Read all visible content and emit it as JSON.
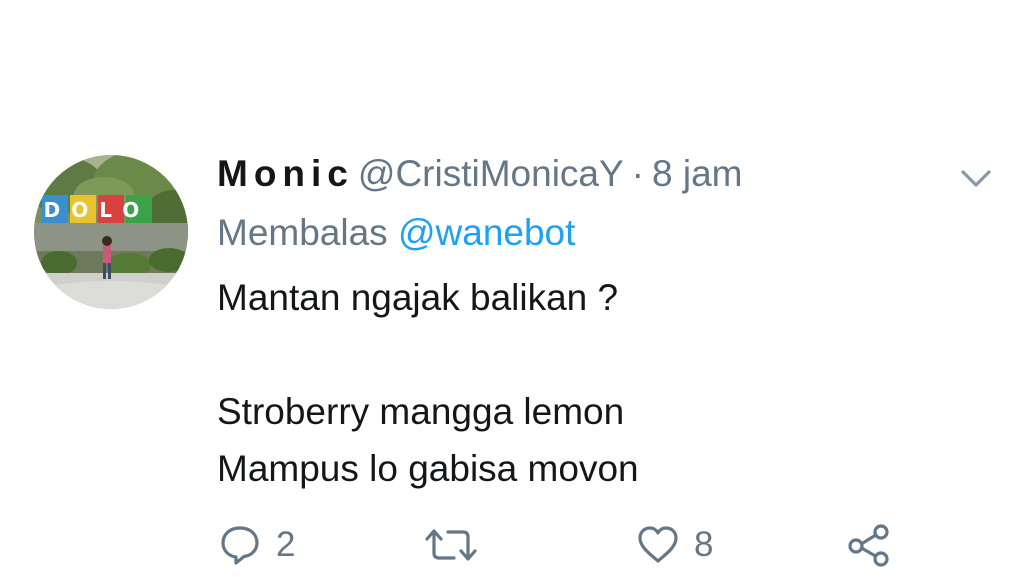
{
  "tweet": {
    "display_name": "Monic",
    "handle": "@CristiMonicaY",
    "separator": "·",
    "time": "8 jam",
    "reply_prefix": "Membalas",
    "reply_to": "@wanebot",
    "text": "Mantan ngajak balikan ?\n\nStroberry mangga lemon\nMampus lo gabisa movon",
    "avatar_sign_text": "DOLO"
  },
  "actions": {
    "reply_count": "2",
    "retweet_count": "",
    "like_count": "8"
  },
  "icons": {
    "caret": "chevron-down-icon",
    "reply": "reply-bubble-icon",
    "retweet": "retweet-icon",
    "like": "heart-icon",
    "share": "share-icon"
  },
  "colors": {
    "text_primary": "#14171a",
    "text_secondary": "#657786",
    "link": "#1da1f2",
    "icon": "#657786"
  }
}
